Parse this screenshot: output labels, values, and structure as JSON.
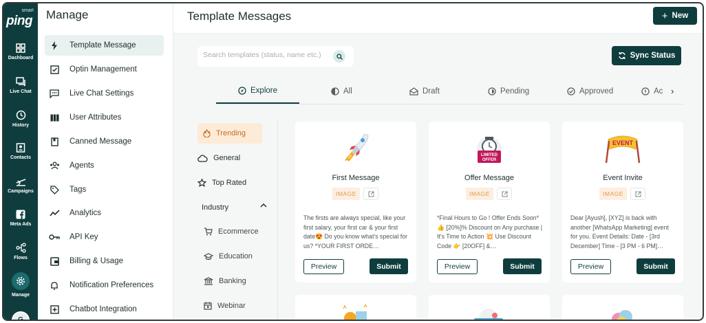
{
  "rail": {
    "logo_small": "smart",
    "logo_main": "ping",
    "items": [
      {
        "label": "Dashboard",
        "icon": "dashboard-icon"
      },
      {
        "label": "Live Chat",
        "icon": "chat-icon"
      },
      {
        "label": "History",
        "icon": "history-icon"
      },
      {
        "label": "Contacts",
        "icon": "contacts-icon"
      },
      {
        "label": "Campaigns",
        "icon": "plane-icon"
      },
      {
        "label": "Meta Ads",
        "icon": "facebook-icon"
      },
      {
        "label": "Flows",
        "icon": "flows-icon"
      },
      {
        "label": "Manage",
        "icon": "gear-icon"
      }
    ],
    "avatar": "G"
  },
  "sidebar": {
    "title": "Manage",
    "items": [
      {
        "label": "Template Message",
        "icon": "bolt-icon"
      },
      {
        "label": "Optin Management",
        "icon": "checkbox-icon"
      },
      {
        "label": "Live Chat Settings",
        "icon": "chat-dots-icon"
      },
      {
        "label": "User Attributes",
        "icon": "columns-icon"
      },
      {
        "label": "Canned Message",
        "icon": "bookmark-icon"
      },
      {
        "label": "Agents",
        "icon": "agents-icon"
      },
      {
        "label": "Tags",
        "icon": "tag-icon"
      },
      {
        "label": "Analytics",
        "icon": "analytics-icon"
      },
      {
        "label": "API Key",
        "icon": "key-icon"
      },
      {
        "label": "Billing & Usage",
        "icon": "wallet-icon"
      },
      {
        "label": "Notification Preferences",
        "icon": "bell-icon"
      },
      {
        "label": "Chatbot Integration",
        "icon": "plus-square-icon"
      }
    ]
  },
  "header": {
    "title": "Template Messages",
    "new_label": "New"
  },
  "search": {
    "placeholder": "Search templates (status, name etc.)"
  },
  "sync_label": "Sync Status",
  "tabs": [
    {
      "label": "Explore"
    },
    {
      "label": "All"
    },
    {
      "label": "Draft"
    },
    {
      "label": "Pending"
    },
    {
      "label": "Approved"
    },
    {
      "label": "Ac"
    }
  ],
  "categories": {
    "items": [
      "Trending",
      "General",
      "Top Rated"
    ],
    "industry_label": "Industry",
    "industry_items": [
      "Ecommerce",
      "Education",
      "Banking",
      "Webinar"
    ]
  },
  "cards": [
    {
      "title": "First Message",
      "badge": "IMAGE",
      "art_icon": "rocket-icon",
      "body": "The firsts are always special, like your first salary, your first car & your first date😍 Do you know what's special for us? *YOUR FIRST ORDE…",
      "preview": "Preview",
      "submit": "Submit"
    },
    {
      "title": "Offer Message",
      "badge": "IMAGE",
      "art_icon": "limited-offer-icon",
      "art_text": "LIMITED OFFER",
      "body": "*Final Hours to Go ! Offer Ends Soon* 👍 [20%]% Discount on Any purchase | It's Time to Action 💥 Use Discount Code 👉 [20OFF] &…",
      "preview": "Preview",
      "submit": "Submit"
    },
    {
      "title": "Event Invite",
      "badge": "IMAGE",
      "art_icon": "event-banner-icon",
      "art_text": "EVENT",
      "body": "Dear [Ayush], [XYZ] is back with another [WhatsApp Marketing] event for you. Event Details: Date - [3rd December] Time - [3 PM - 6 PM]…",
      "preview": "Preview",
      "submit": "Submit"
    }
  ],
  "colors": {
    "primary": "#0f3d3e",
    "accent_orange": "#e09a55",
    "trending_bg": "#fdebd8"
  }
}
